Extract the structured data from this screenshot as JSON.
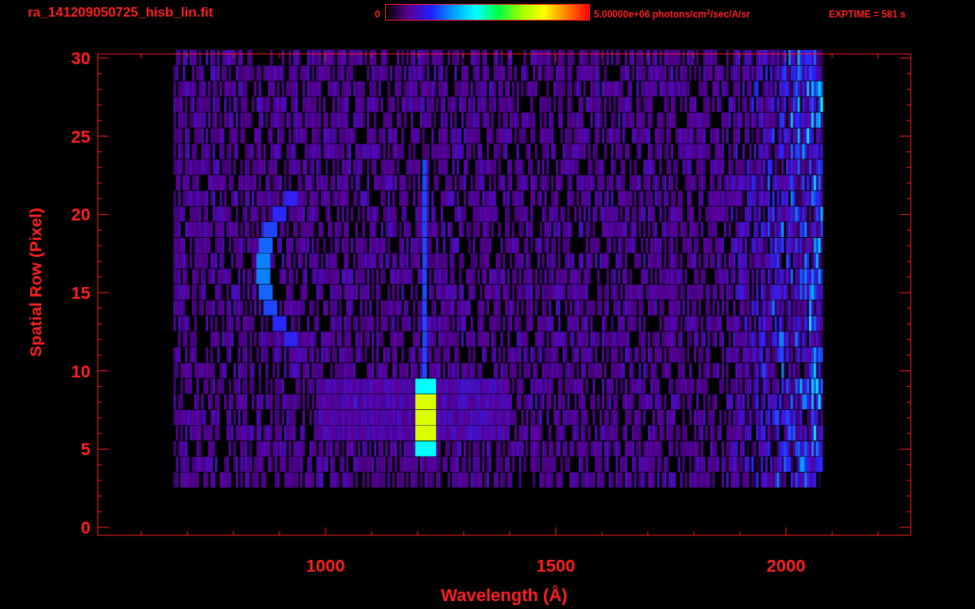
{
  "title": "ra_141209050725_hisb_lin.fit",
  "colorbar": {
    "min_label": "0",
    "max_label": "5.00000e+06 photons/cm$^{2}$/sec/A/sr"
  },
  "exposure": "EXPTIME = 581 s",
  "plot": {
    "xlabel": "Wavelength (Å)",
    "ylabel": "Spatial Row (Pixel)",
    "xticks": [
      "1000",
      "1500",
      "2000"
    ],
    "yticks": [
      "30",
      "25",
      "20",
      "15",
      "10",
      "5",
      "0"
    ]
  }
}
